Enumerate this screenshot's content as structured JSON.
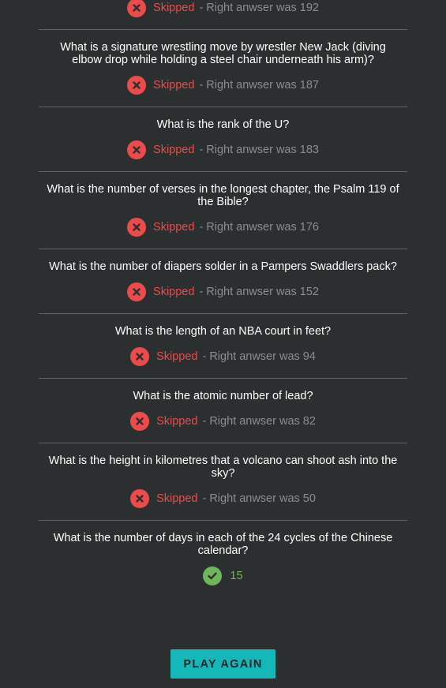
{
  "results": {
    "items": [
      {
        "question": "",
        "status": "Skipped",
        "right_answer": "- Right anwser was 192",
        "correct": false
      },
      {
        "question": "What is a signature wrestling move by wrestler New Jack (diving elbow drop while holding a steel chair underneath his arm)?",
        "status": "Skipped",
        "right_answer": "- Right anwser was 187",
        "correct": false
      },
      {
        "question": "What is the rank of the U?",
        "status": "Skipped",
        "right_answer": "- Right anwser was 183",
        "correct": false
      },
      {
        "question": "What is the number of verses in the longest chapter, the Psalm 119 of the Bible?",
        "status": "Skipped",
        "right_answer": "- Right anwser was 176",
        "correct": false
      },
      {
        "question": "What is the number of diapers solder in a Pampers Swaddlers pack?",
        "status": "Skipped",
        "right_answer": "- Right anwser was 152",
        "correct": false
      },
      {
        "question": "What is the length of an NBA court in feet?",
        "status": "Skipped",
        "right_answer": "- Right anwser was 94",
        "correct": false
      },
      {
        "question": "What is the atomic number of lead?",
        "status": "Skipped",
        "right_answer": "- Right anwser was 82",
        "correct": false
      },
      {
        "question": "What is the height in kilometres that a volcano can shoot ash into the sky?",
        "status": "Skipped",
        "right_answer": "- Right anwser was 50",
        "correct": false
      },
      {
        "question": "What is the number of days in each of the 24 cycles of the Chinese calendar?",
        "answer": "15",
        "correct": true
      }
    ]
  },
  "icons": {
    "wrong": "close-icon",
    "right": "check-icon"
  },
  "colors": {
    "background": "#2b2f2f",
    "wrong": "#ec4b4b",
    "right": "#6fb55c",
    "muted": "#8a8e8e",
    "button": "#14b8b8"
  },
  "play_again": {
    "label": "PLAY AGAIN"
  }
}
